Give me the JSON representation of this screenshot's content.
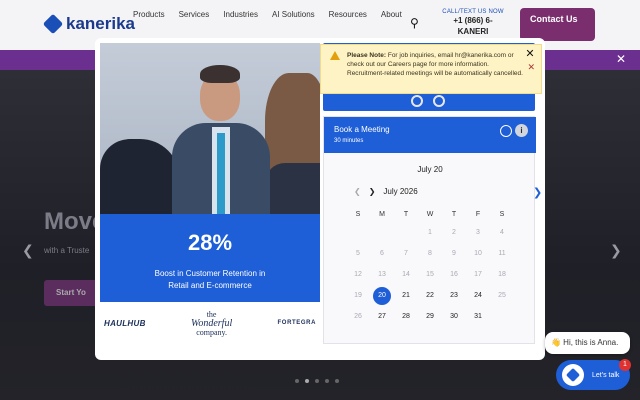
{
  "header": {
    "logo_text": "kanerika",
    "nav": [
      "Products",
      "Services",
      "Industries",
      "AI Solutions",
      "Resources",
      "About"
    ],
    "call_label": "CALL/TEXT US NOW",
    "phone_line1": "+1 (866) 6-",
    "phone_line2": "KANERI",
    "contact_label": "Contact Us"
  },
  "hero": {
    "title": "Move",
    "subtitle": "with a Truste",
    "cta": "Start Yo"
  },
  "promo": {
    "stat": "28%",
    "stat_text_1": "Boost in Customer Retention in",
    "stat_text_2": "Retail and E-commerce",
    "logos": {
      "haulhub": "HAULHUB",
      "wonderful_1": "the",
      "wonderful_2": "Wonderful",
      "wonderful_3": "company.",
      "fortegra": "FORTEGRA"
    }
  },
  "note": {
    "label": "Please Note:",
    "text": "For job inquiries, email hr@kanerika.com or check out our Careers page for more information. Recruitment-related meetings will be automatically cancelled."
  },
  "booking": {
    "title": "Book a Meeting",
    "duration": "30 minutes",
    "date_label": "July 20",
    "month_label": "July 2026",
    "weekdays": [
      "S",
      "M",
      "T",
      "W",
      "T",
      "F",
      "S"
    ],
    "selected_day": "20"
  },
  "chat": {
    "greeting": "👋 Hi, this is Anna.",
    "button_label": "Let's talk",
    "badge": "1"
  },
  "colors": {
    "brand_blue": "#1e5ed6",
    "banner_purple": "#6b2f8f",
    "note_bg": "#fdf3c5"
  }
}
